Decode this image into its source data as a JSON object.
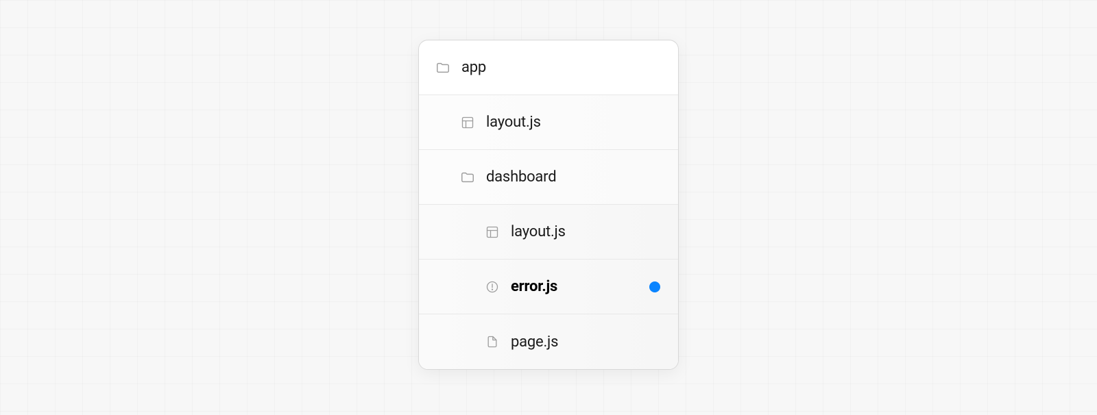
{
  "tree": {
    "root": {
      "label": "app",
      "icon": "folder"
    },
    "items": [
      {
        "label": "layout.js",
        "icon": "layout",
        "indent": 1,
        "bold": false,
        "dot": false
      },
      {
        "label": "dashboard",
        "icon": "folder",
        "indent": 1,
        "bold": false,
        "dot": false
      },
      {
        "label": "layout.js",
        "icon": "layout",
        "indent": 2,
        "bold": false,
        "dot": false
      },
      {
        "label": "error.js",
        "icon": "error",
        "indent": 2,
        "bold": true,
        "dot": true
      },
      {
        "label": "page.js",
        "icon": "file",
        "indent": 2,
        "bold": false,
        "dot": false
      }
    ]
  },
  "colors": {
    "dot": "#0a84ff",
    "icon_stroke": "#9e9e9e"
  }
}
